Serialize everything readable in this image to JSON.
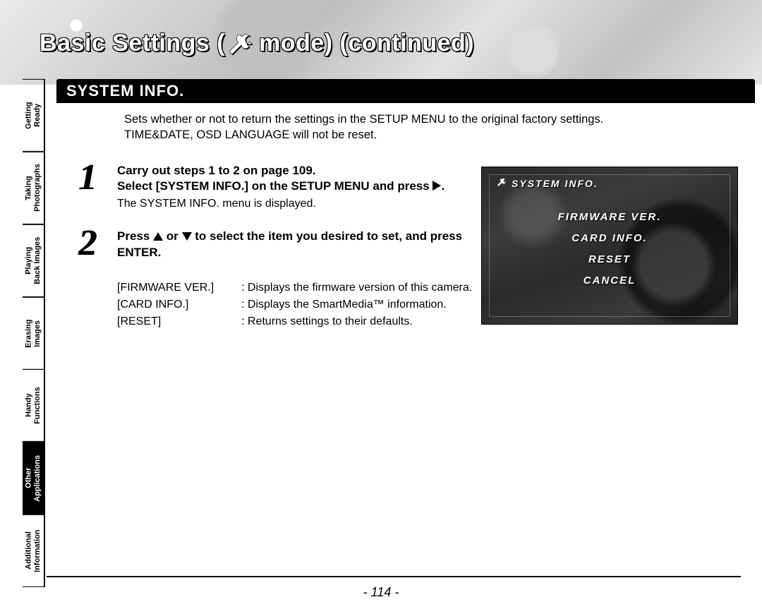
{
  "header": {
    "title_prefix": "Basic Settings (",
    "title_suffix": " mode) (continued)"
  },
  "sections": {
    "system_info_heading": "SYSTEM INFO."
  },
  "sidebar": {
    "tabs": [
      {
        "label": "Getting\nReady",
        "active": false
      },
      {
        "label": "Taking\nPhotographs",
        "active": false
      },
      {
        "label": "Playing\nBack Images",
        "active": false
      },
      {
        "label": "Erasing\nImages",
        "active": false
      },
      {
        "label": "Handy\nFunctions",
        "active": false
      },
      {
        "label": "Other\nApplications",
        "active": true
      },
      {
        "label": "Additional\nInformation",
        "active": false
      }
    ]
  },
  "body": {
    "intro_line1": "Sets whether or not to return the settings in the SETUP MENU to the original factory settings.",
    "intro_line2": "TIME&DATE, OSD LANGUAGE will not be reset.",
    "step1": {
      "line1": "Carry out steps 1 to 2 on page 109.",
      "line2a": "Select [SYSTEM INFO.] on the SETUP MENU and press ",
      "line2b": ".",
      "sub": "The SYSTEM INFO. menu is displayed."
    },
    "step2": {
      "line_a": "Press ",
      "line_mid": " or ",
      "line_b": " to select the item you desired to set, and press ENTER."
    },
    "definitions": [
      {
        "term": "[FIRMWARE VER.]",
        "sep": " : ",
        "desc": "Displays the firmware version of this camera."
      },
      {
        "term": "[CARD INFO.]",
        "sep": " : ",
        "desc": "Displays the SmartMedia™ information."
      },
      {
        "term": "[RESET]",
        "sep": " : ",
        "desc": "Returns settings to their defaults."
      }
    ]
  },
  "lcd": {
    "title": "SYSTEM INFO.",
    "items": [
      "FIRMWARE VER.",
      "CARD INFO.",
      "RESET",
      "CANCEL"
    ]
  },
  "page_number": "- 114 -"
}
